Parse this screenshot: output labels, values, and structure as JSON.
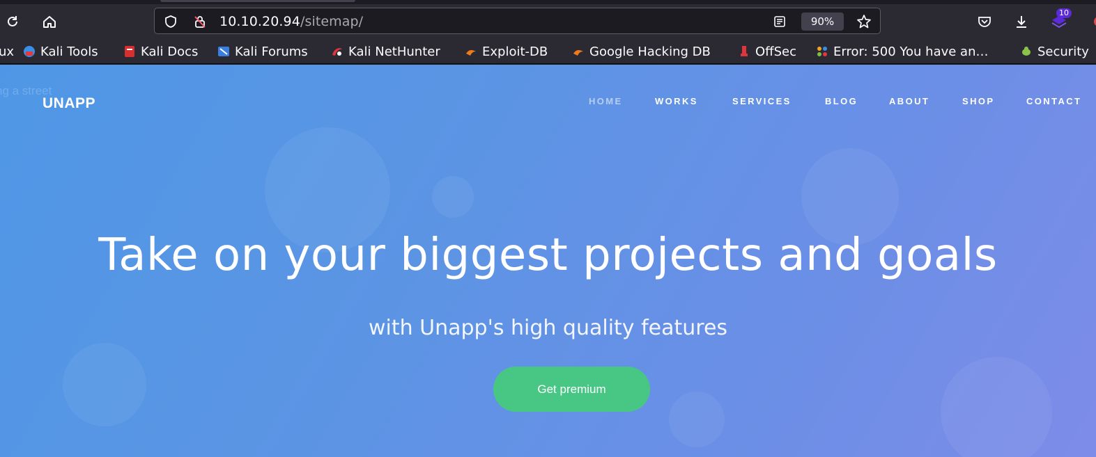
{
  "browser": {
    "url_host": "10.10.20.94",
    "url_path": "/sitemap/",
    "zoom": "90%",
    "extension_badge": "10",
    "icons": [
      "reload-icon",
      "home-icon",
      "shield-icon",
      "insecure-lock-icon",
      "reader-view-icon",
      "bookmark-star-icon",
      "pocket-icon",
      "download-icon",
      "extension-icon"
    ]
  },
  "bookmarks": [
    {
      "label": "ux"
    },
    {
      "label": "Kali Tools"
    },
    {
      "label": "Kali Docs"
    },
    {
      "label": "Kali Forums"
    },
    {
      "label": "Kali NetHunter"
    },
    {
      "label": "Exploit-DB"
    },
    {
      "label": "Google Hacking DB"
    },
    {
      "label": "OffSec"
    },
    {
      "label": "Error: 500 You have an…"
    },
    {
      "label": "Security"
    }
  ],
  "site": {
    "ghost_text": "ng a street",
    "logo": "UNAPP",
    "nav": [
      "HOME",
      "WORKS",
      "SERVICES",
      "BLOG",
      "ABOUT",
      "SHOP",
      "CONTACT"
    ],
    "active_nav": "HOME",
    "hero_title": "Take on your biggest projects and goals",
    "hero_subtitle": "with Unapp's high quality features",
    "cta_label": "Get premium"
  },
  "colors": {
    "chrome": "#2b2a33",
    "accent_green": "#48c784",
    "hero_blue": "#5a95e4"
  }
}
